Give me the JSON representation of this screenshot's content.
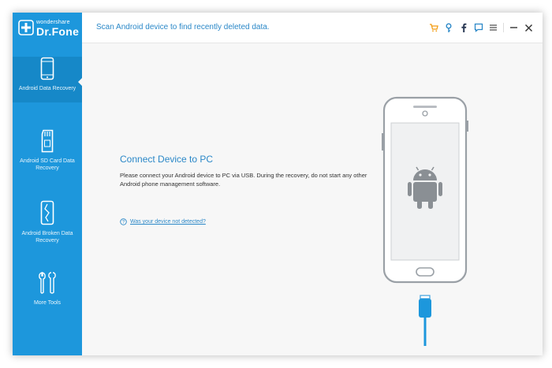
{
  "app": {
    "brand_small": "wondershare",
    "brand_name": "Dr.Fone",
    "accent_color": "#1d97dc"
  },
  "header": {
    "title": "Scan Android device to find recently deleted data.",
    "icons": [
      "cart-icon",
      "key-icon",
      "facebook-icon",
      "feedback-icon",
      "menu-icon",
      "minimize-icon",
      "close-icon"
    ]
  },
  "sidebar": {
    "items": [
      {
        "label": "Android Data Recovery",
        "icon": "phone-icon",
        "active": true
      },
      {
        "label": "Android SD Card Data Recovery",
        "icon": "sd-card-icon",
        "active": false
      },
      {
        "label": "Android Broken Data Recovery",
        "icon": "broken-phone-icon",
        "active": false
      },
      {
        "label": "More Tools",
        "icon": "tools-icon",
        "active": false
      }
    ]
  },
  "main": {
    "title": "Connect Device to PC",
    "description": "Please connect your Android device to PC via USB. During the recovery, do not start any other Android phone management software.",
    "help_link": "Was your device not detected?"
  }
}
